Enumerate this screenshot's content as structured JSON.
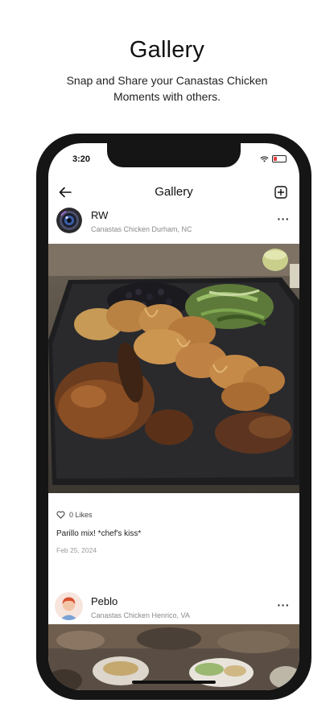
{
  "promo": {
    "title": "Gallery",
    "subtitle": "Snap and Share your Canastas Chicken Moments with others."
  },
  "status_bar": {
    "time": "3:20"
  },
  "header": {
    "title": "Gallery",
    "back_icon": "arrow-left-icon",
    "add_icon": "plus-square-icon"
  },
  "posts": [
    {
      "user": "RW",
      "location": "Canastas Chicken Durham, NC",
      "likes": "0 Likes",
      "caption": "Parillo mix! *chef's kiss*",
      "date": "Feb 25, 2024"
    },
    {
      "user": "Peblo",
      "location": "Canastas Chicken Henrico, VA"
    }
  ],
  "colors": {
    "battery": "#e23a3a",
    "phone_frame": "#151515"
  }
}
